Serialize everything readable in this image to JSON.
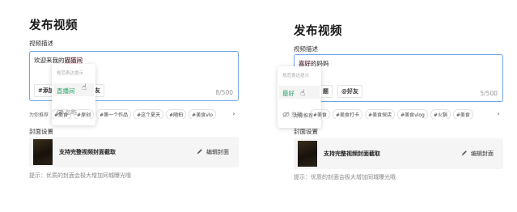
{
  "left": {
    "title": "发布视频",
    "desc_label": "视频描述",
    "text_before": "欢迎来我的",
    "text_highlight": "猫猫间",
    "chips": [
      "#添加话题",
      "@好友"
    ],
    "chips_visible": [
      "#添加",
      "友"
    ],
    "counter": "8/500",
    "popup": {
      "hint": "规范表达提示",
      "option": "直播间",
      "ignore": "忽略"
    },
    "tags_lead": "为你推荐",
    "tags": [
      "#美食",
      "#原创",
      "#第一个作品",
      "#这个夏天",
      "#随拍",
      "#美食vlo"
    ],
    "cover_label": "封面设置",
    "cover_text": "支持完整视频封面截取",
    "cover_edit": "编辑封面",
    "tip": "提示：优质的封面会极大增加同城曝光哦"
  },
  "right": {
    "title": "发布视频",
    "desc_label": "视频描述",
    "text_highlight": "喜好",
    "text_after": "的妈妈",
    "chips_visible": [
      "题",
      "@好友"
    ],
    "counter": "5/500",
    "popup": {
      "hint": "规范表达提示",
      "option": "最好",
      "ignore": "忽略"
    },
    "tags_lead": "为你推荐",
    "tags": [
      "#美食",
      "#美食打卡",
      "#美食探店",
      "#美食vlog",
      "#火锅",
      "#美食"
    ],
    "cover_label": "封面设置",
    "cover_text": "支持完整视频封面截取",
    "cover_edit": "编辑封面",
    "tip": "提示：优质的封面会极大增加同城曝光哦"
  },
  "icons": {
    "ignore": "eye-off-icon",
    "edit": "pencil-icon",
    "arrow": "chevron-right-icon",
    "cursor": "hand-pointer-icon"
  },
  "colors": {
    "accent_green": "#2ba36b",
    "highlight_pink": "#e0506f",
    "focus_blue": "#6fa3e6"
  }
}
